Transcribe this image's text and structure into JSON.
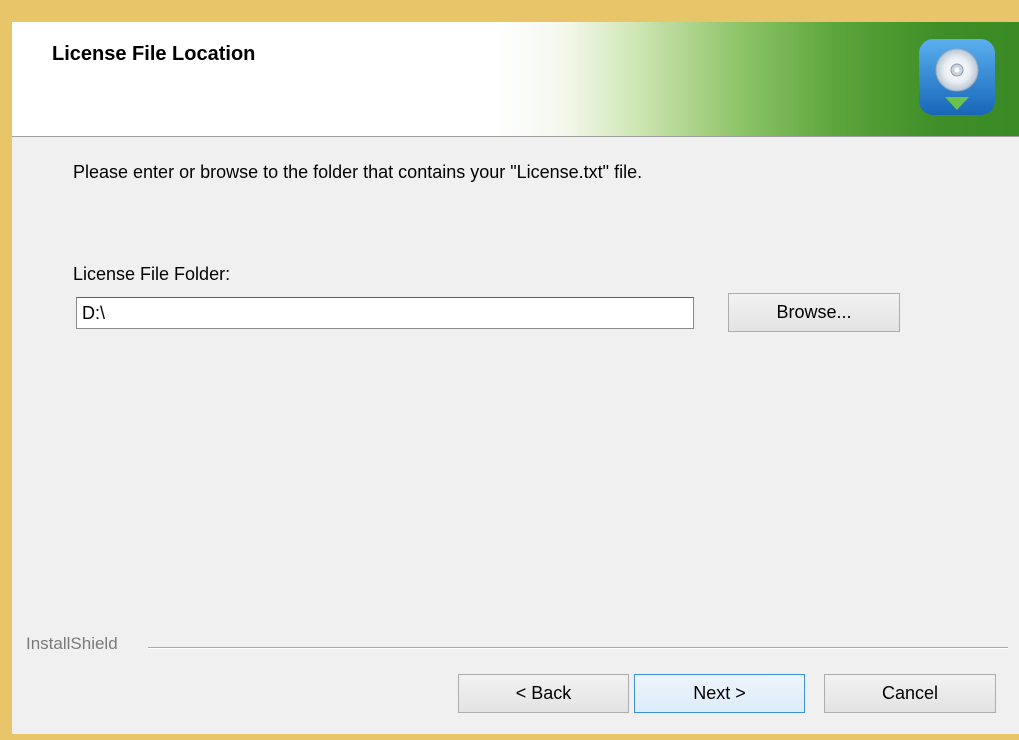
{
  "header": {
    "title": "License File Location",
    "icon": "install-cd-icon"
  },
  "main": {
    "instruction": "Please enter or browse to the folder that contains your \"License.txt\" file.",
    "folder_label": "License File Folder:",
    "folder_value": "D:\\",
    "browse_label": "Browse..."
  },
  "footer": {
    "brand": "InstallShield",
    "back_label": "< Back",
    "next_label": "Next >",
    "cancel_label": "Cancel"
  },
  "colors": {
    "accent_green": "#3a8a25",
    "icon_blue": "#1f7fd0",
    "frame": "#e9c56a"
  }
}
